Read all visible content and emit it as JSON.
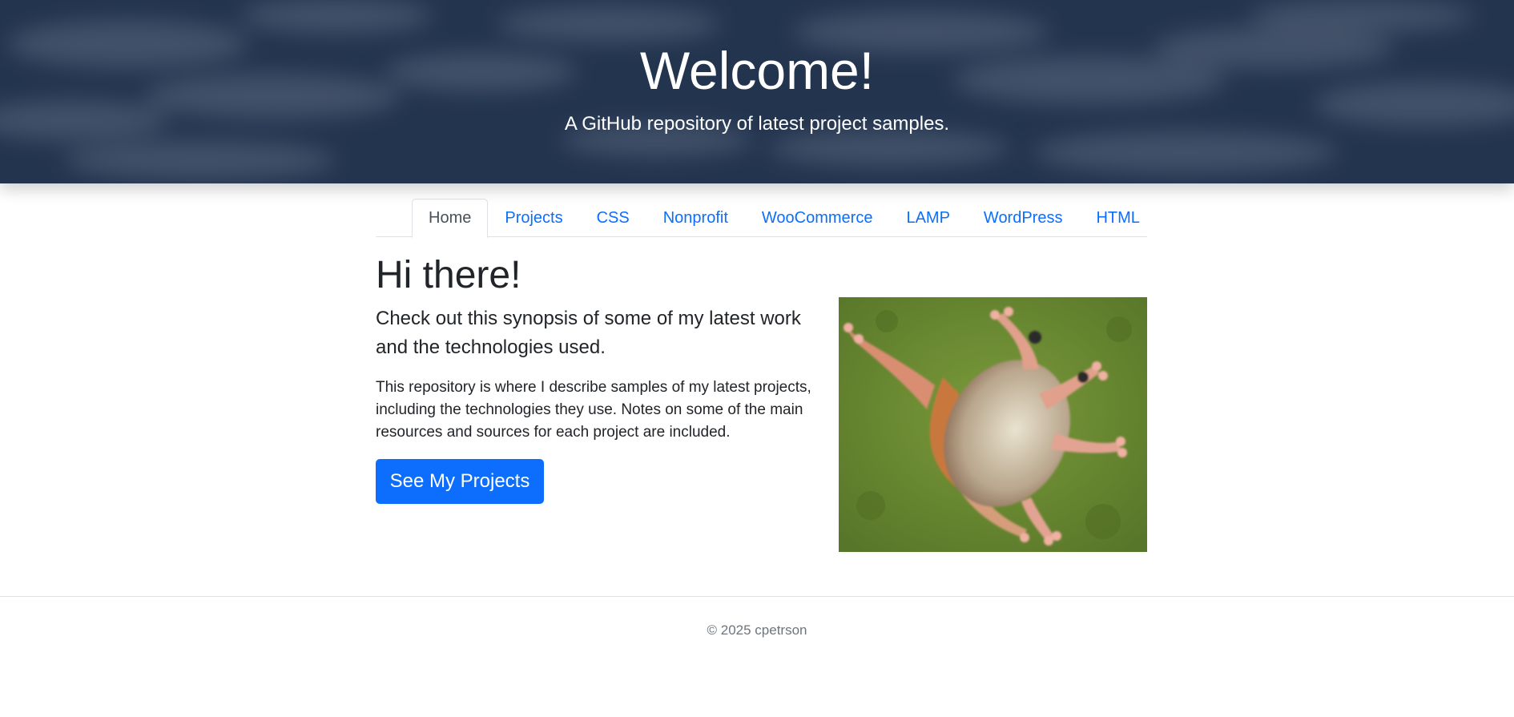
{
  "hero": {
    "title": "Welcome!",
    "subtitle": "A GitHub repository of latest project samples."
  },
  "nav": {
    "tabs": [
      {
        "label": "Home",
        "active": true
      },
      {
        "label": "Projects",
        "active": false
      },
      {
        "label": "CSS",
        "active": false
      },
      {
        "label": "Nonprofit",
        "active": false
      },
      {
        "label": "WooCommerce",
        "active": false
      },
      {
        "label": "LAMP",
        "active": false
      },
      {
        "label": "WordPress",
        "active": false
      },
      {
        "label": "HTML",
        "active": false
      }
    ]
  },
  "main": {
    "heading": "Hi there!",
    "lead": "Check out this synopsis of some of my latest work and the technologies used.",
    "body": "This repository is where I describe samples of my latest projects, including the technologies they use. Notes on some of the main resources and sources for each project are included.",
    "cta_label": "See My Projects",
    "photo_icon": "frog-photo"
  },
  "footer": {
    "copyright": "© 2025 cpetrson"
  },
  "colors": {
    "hero_bg": "#23344f",
    "link": "#0d6efd",
    "button": "#0d6efd",
    "text": "#212529",
    "muted": "#6c757d"
  }
}
